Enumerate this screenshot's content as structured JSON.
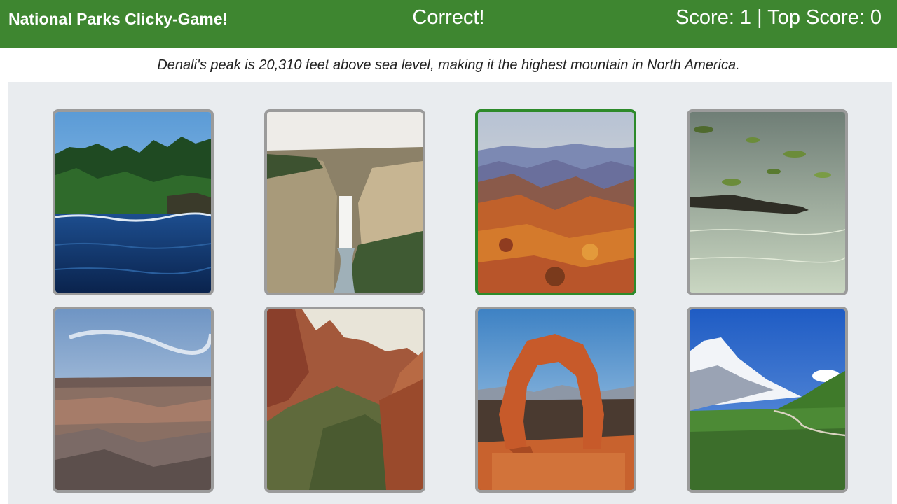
{
  "header": {
    "brand": "National Parks Clicky-Game!",
    "status": "Correct!",
    "score_text": "Score: 1 | Top Score: 0",
    "background_color": "#3e8630"
  },
  "fact": "Denali's peak is 20,310 feet above sea level, making it the highest mountain in North America.",
  "cards": [
    {
      "icon": "lake-shore-photo"
    },
    {
      "icon": "waterfall-canyon-photo"
    },
    {
      "icon": "autumn-mountains-photo",
      "highlighted": true
    },
    {
      "icon": "alligator-swamp-photo"
    },
    {
      "icon": "grand-canyon-photo"
    },
    {
      "icon": "red-canyon-photo"
    },
    {
      "icon": "rock-arch-photo"
    },
    {
      "icon": "snow-mountain-photo"
    }
  ],
  "colors": {
    "card_border": "#9b9b9b",
    "card_highlight_border": "#2d8a2a",
    "board_background": "#e9ecef"
  }
}
